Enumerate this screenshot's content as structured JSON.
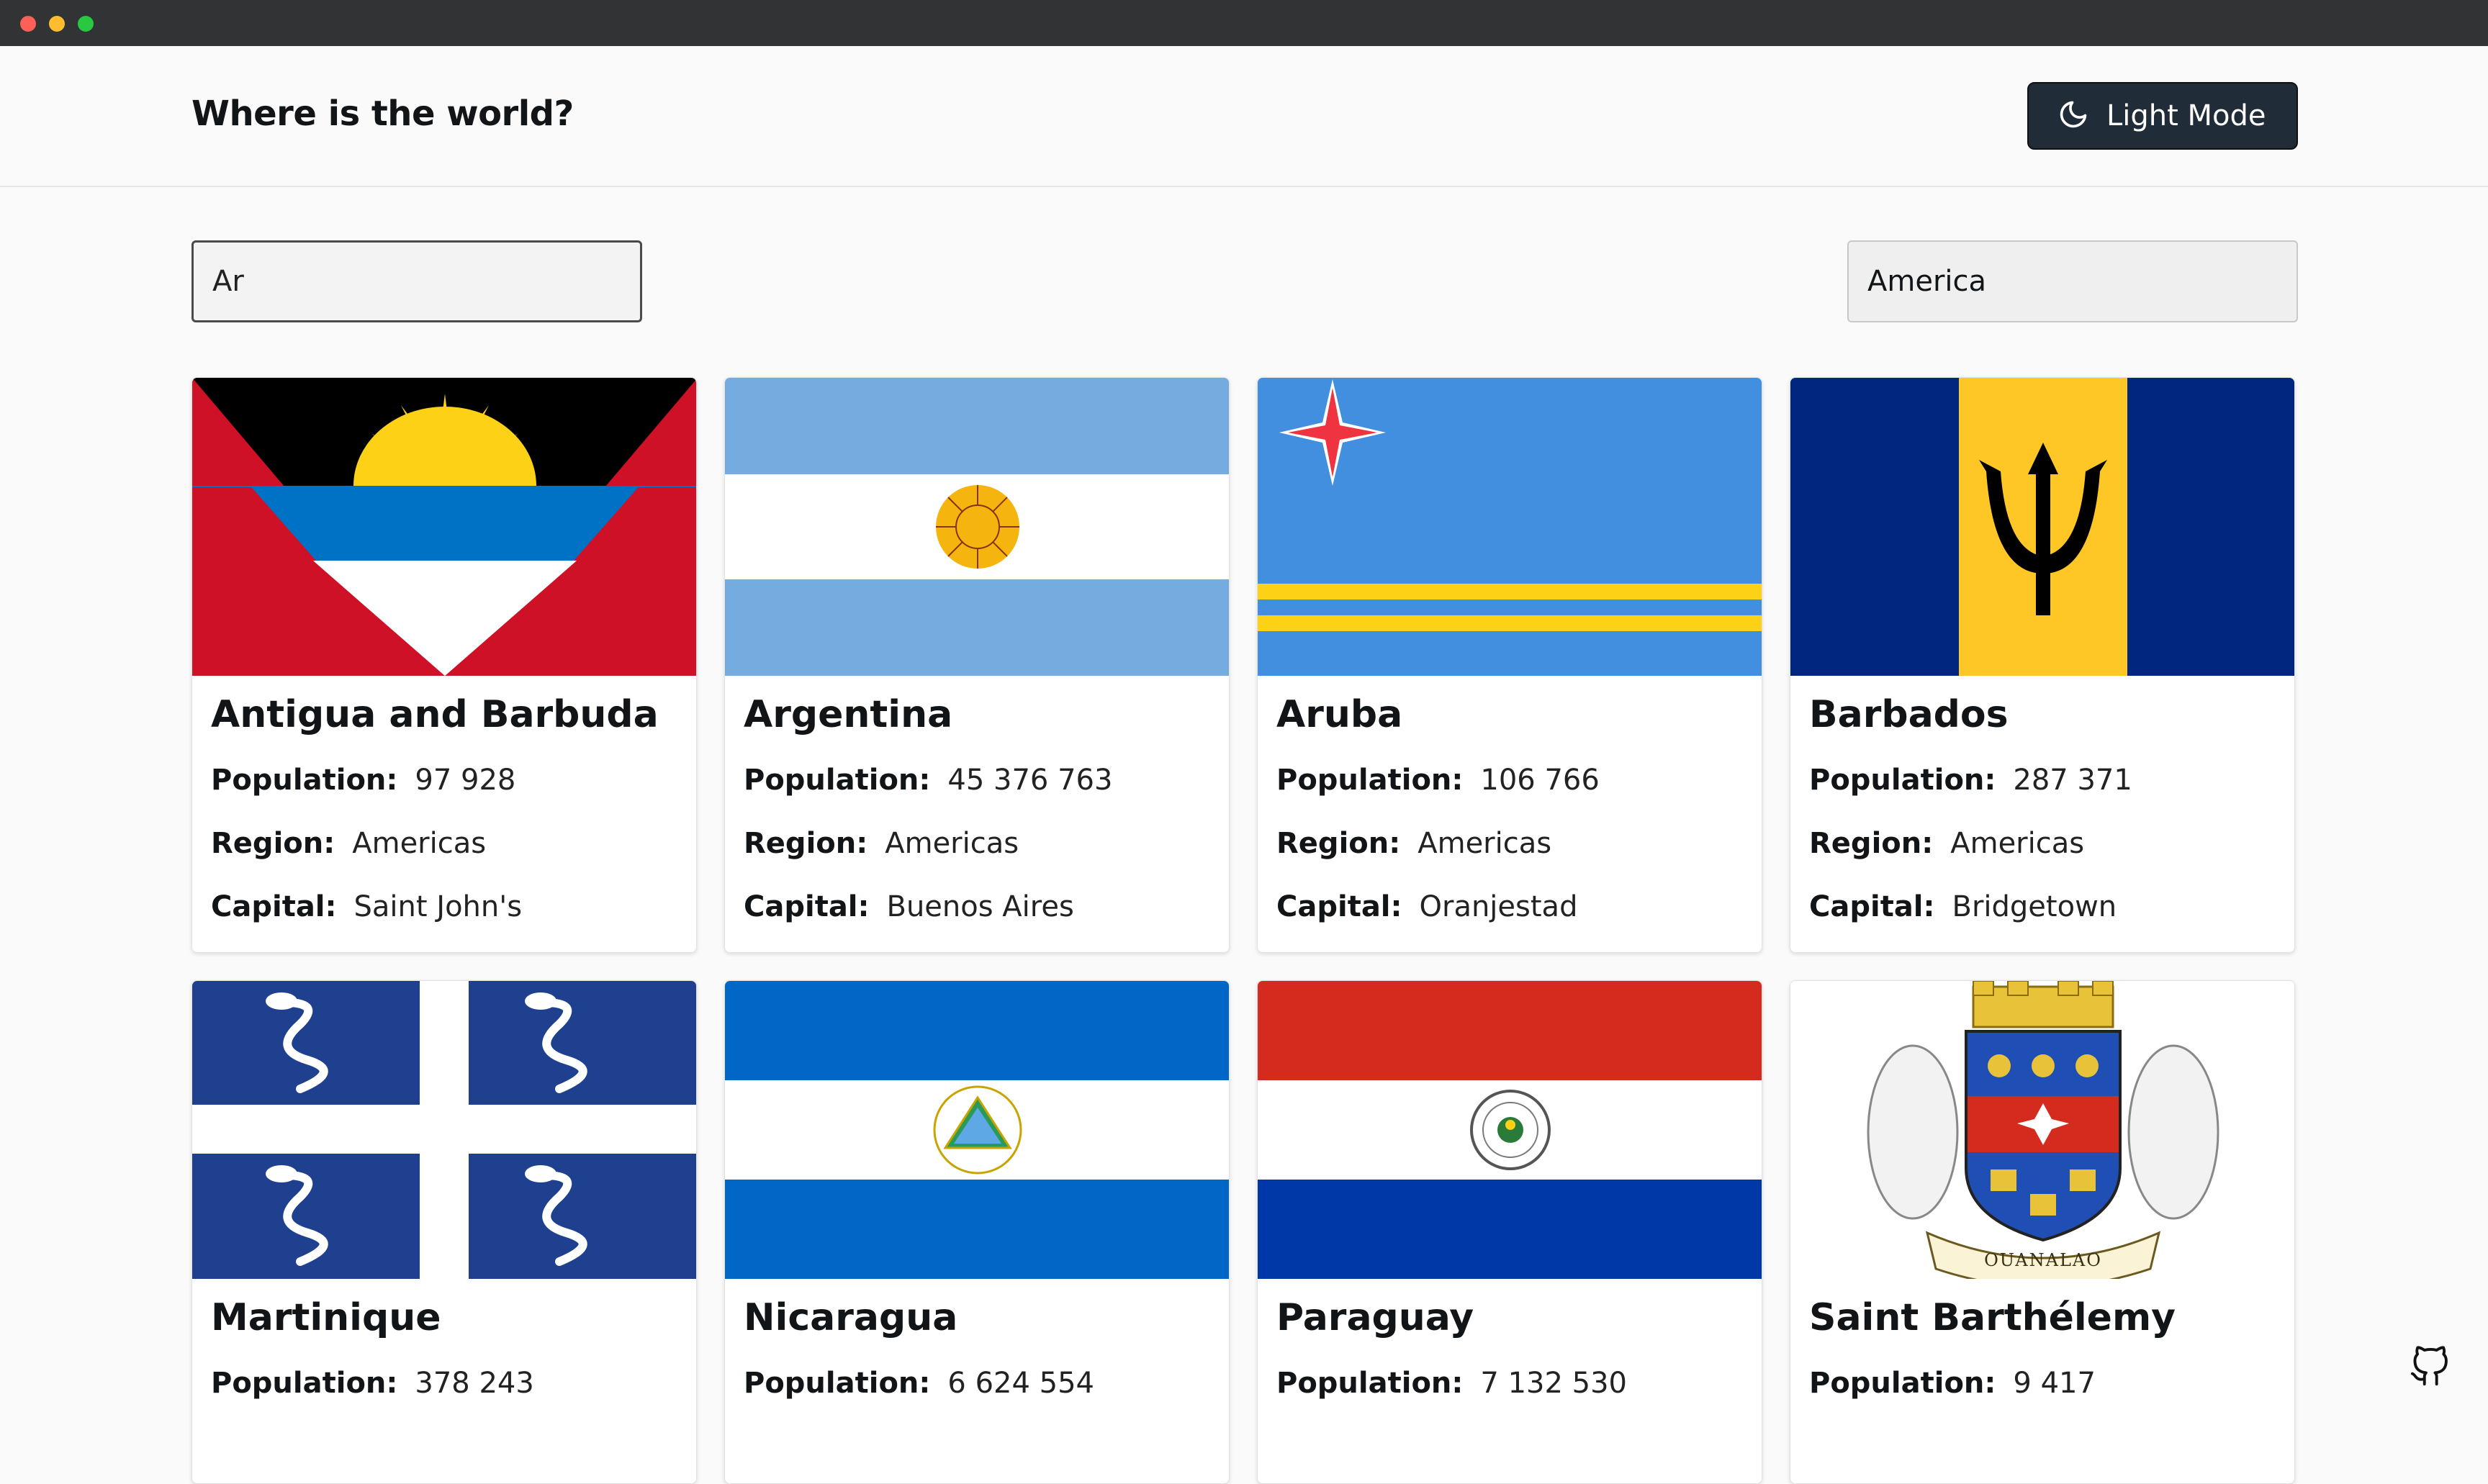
{
  "app": {
    "title": "Where is the world?",
    "mode_button": "Light Mode"
  },
  "search": {
    "value": "Ar"
  },
  "filter": {
    "selected": "America"
  },
  "labels": {
    "population": "Population:",
    "region": "Region:",
    "capital": "Capital:"
  },
  "countries": [
    {
      "name": "Antigua and Barbuda",
      "population": "97 928",
      "region": "Americas",
      "capital": "Saint John's",
      "flag": "antigua-flag"
    },
    {
      "name": "Argentina",
      "population": "45 376 763",
      "region": "Americas",
      "capital": "Buenos Aires",
      "flag": "argentina-flag"
    },
    {
      "name": "Aruba",
      "population": "106 766",
      "region": "Americas",
      "capital": "Oranjestad",
      "flag": "aruba-flag"
    },
    {
      "name": "Barbados",
      "population": "287 371",
      "region": "Americas",
      "capital": "Bridgetown",
      "flag": "barbados-flag"
    },
    {
      "name": "Martinique",
      "population": "378 243",
      "flag": "martinique-flag"
    },
    {
      "name": "Nicaragua",
      "population": "6 624 554",
      "flag": "nicaragua-flag"
    },
    {
      "name": "Paraguay",
      "population": "7 132 530",
      "flag": "paraguay-flag"
    },
    {
      "name": "Saint Barthélemy",
      "population": "9 417",
      "flag": "saint-barthelemy-flag",
      "flag_motto": "OUANALAO"
    }
  ],
  "icons": {
    "mode": "moon-icon",
    "github": "github-icon"
  },
  "colors": {
    "button_bg": "#202c37",
    "page_bg": "#fafafa",
    "card_bg": "#ffffff",
    "text": "#111517"
  }
}
